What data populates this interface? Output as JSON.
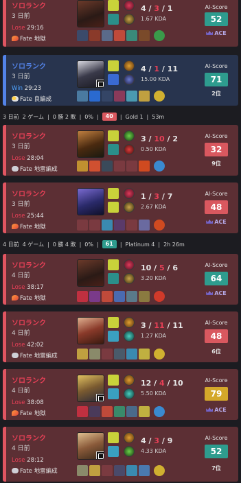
{
  "colors": {
    "loss_bg": "#5c2f34",
    "loss_border": "#e05561",
    "win_bg": "#28344e",
    "win_border": "#5383e8",
    "score_teal": "#2e9c8e",
    "score_red": "#d9585f",
    "score_yellow": "#d4a82a"
  },
  "day_summaries": [
    {
      "ago": "3 日前",
      "games": "2 ゲーム",
      "record": "0 勝 2 敗",
      "winrate": "0%",
      "score": "40",
      "rank": "Gold 1",
      "duration": "53m"
    },
    {
      "ago": "4 日前",
      "games": "4 ゲーム",
      "record": "0 勝 4 敗",
      "winrate": "0%",
      "score": "61",
      "rank": "Platinum 4",
      "duration": "2h 26m"
    }
  ],
  "matches": [
    {
      "queue": "ソロランク",
      "ago": "3 日前",
      "result": "Lose",
      "duration": "29:16",
      "fate": "Fate 地獄",
      "champion_icon": "darius-portrait",
      "k": "4",
      "d": "3",
      "a": "1",
      "kda": "1.67 KDA",
      "ai_label": "AI-Score",
      "score": "52",
      "rank": "ACE"
    },
    {
      "queue": "ソロランク",
      "ago": "3 日前",
      "result": "Win",
      "duration": "29:23",
      "fate": "Fate 良編成",
      "champion_icon": "yone-portrait",
      "k": "4",
      "d": "1",
      "a": "11",
      "kda": "15.00 KDA",
      "ai_label": "AI-Score",
      "score": "71",
      "rank": "2位"
    },
    {
      "queue": "ソロランク",
      "ago": "3 日前",
      "result": "Lose",
      "duration": "28:04",
      "fate": "Fate 地雷編成",
      "champion_icon": "mordekaiser-portrait",
      "k": "3",
      "d": "10",
      "a": "2",
      "kda": "0.50 KDA",
      "ai_label": "AI-Score",
      "score": "32",
      "rank": "9位"
    },
    {
      "queue": "ソロランク",
      "ago": "3 日前",
      "result": "Lose",
      "duration": "25:44",
      "fate": "Fate 地獄",
      "champion_icon": "kassadin-portrait",
      "k": "1",
      "d": "3",
      "a": "7",
      "kda": "2.67 KDA",
      "ai_label": "AI-Score",
      "score": "48",
      "rank": "ACE"
    },
    {
      "queue": "ソロランク",
      "ago": "4 日前",
      "result": "Lose",
      "duration": "38:17",
      "fate": "Fate 地獄",
      "champion_icon": "darius-portrait",
      "k": "10",
      "d": "5",
      "a": "6",
      "kda": "3.20 KDA",
      "ai_label": "AI-Score",
      "score": "64",
      "rank": "ACE"
    },
    {
      "queue": "ソロランク",
      "ago": "4 日前",
      "result": "Lose",
      "duration": "42:02",
      "fate": "Fate 地雷編成",
      "champion_icon": "riven-portrait",
      "k": "3",
      "d": "11",
      "a": "11",
      "kda": "1.27 KDA",
      "ai_label": "AI-Score",
      "score": "48",
      "rank": "6位"
    },
    {
      "queue": "ソロランク",
      "ago": "4 日前",
      "result": "Lose",
      "duration": "38:08",
      "fate": "Fate 地獄",
      "champion_icon": "ezreal-portrait",
      "k": "12",
      "d": "4",
      "a": "10",
      "kda": "5.50 KDA",
      "ai_label": "AI-Score",
      "score": "79",
      "rank": "ACE"
    },
    {
      "queue": "ソロランク",
      "ago": "4 日前",
      "result": "Lose",
      "duration": "28:12",
      "fate": "Fate 地雷編成",
      "champion_icon": "irelia-portrait",
      "k": "4",
      "d": "3",
      "a": "9",
      "kda": "4.33 KDA",
      "ai_label": "AI-Score",
      "score": "52",
      "rank": "7位"
    }
  ]
}
